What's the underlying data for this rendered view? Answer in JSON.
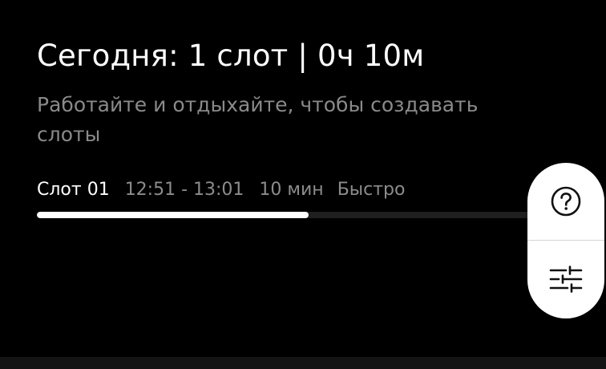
{
  "summary": {
    "title": "Сегодня: 1 слот | 0ч 10м",
    "subtitle": "Работайте и отдыхайте, чтобы создавать слоты"
  },
  "slot": {
    "name": "Слот 01",
    "time_range": "12:51 - 13:01",
    "duration": "10 мин",
    "speed": "Быстро",
    "progress_percent": 53
  },
  "actions": {
    "help_icon": "question-circle-icon",
    "settings_icon": "sliders-icon"
  },
  "colors": {
    "background": "#000000",
    "text_primary": "#ffffff",
    "text_secondary": "#8a8a8a",
    "progress_fill": "#ffffff",
    "progress_track": "#1f1f1f",
    "fab_background": "#ffffff",
    "icon": "#111111"
  }
}
